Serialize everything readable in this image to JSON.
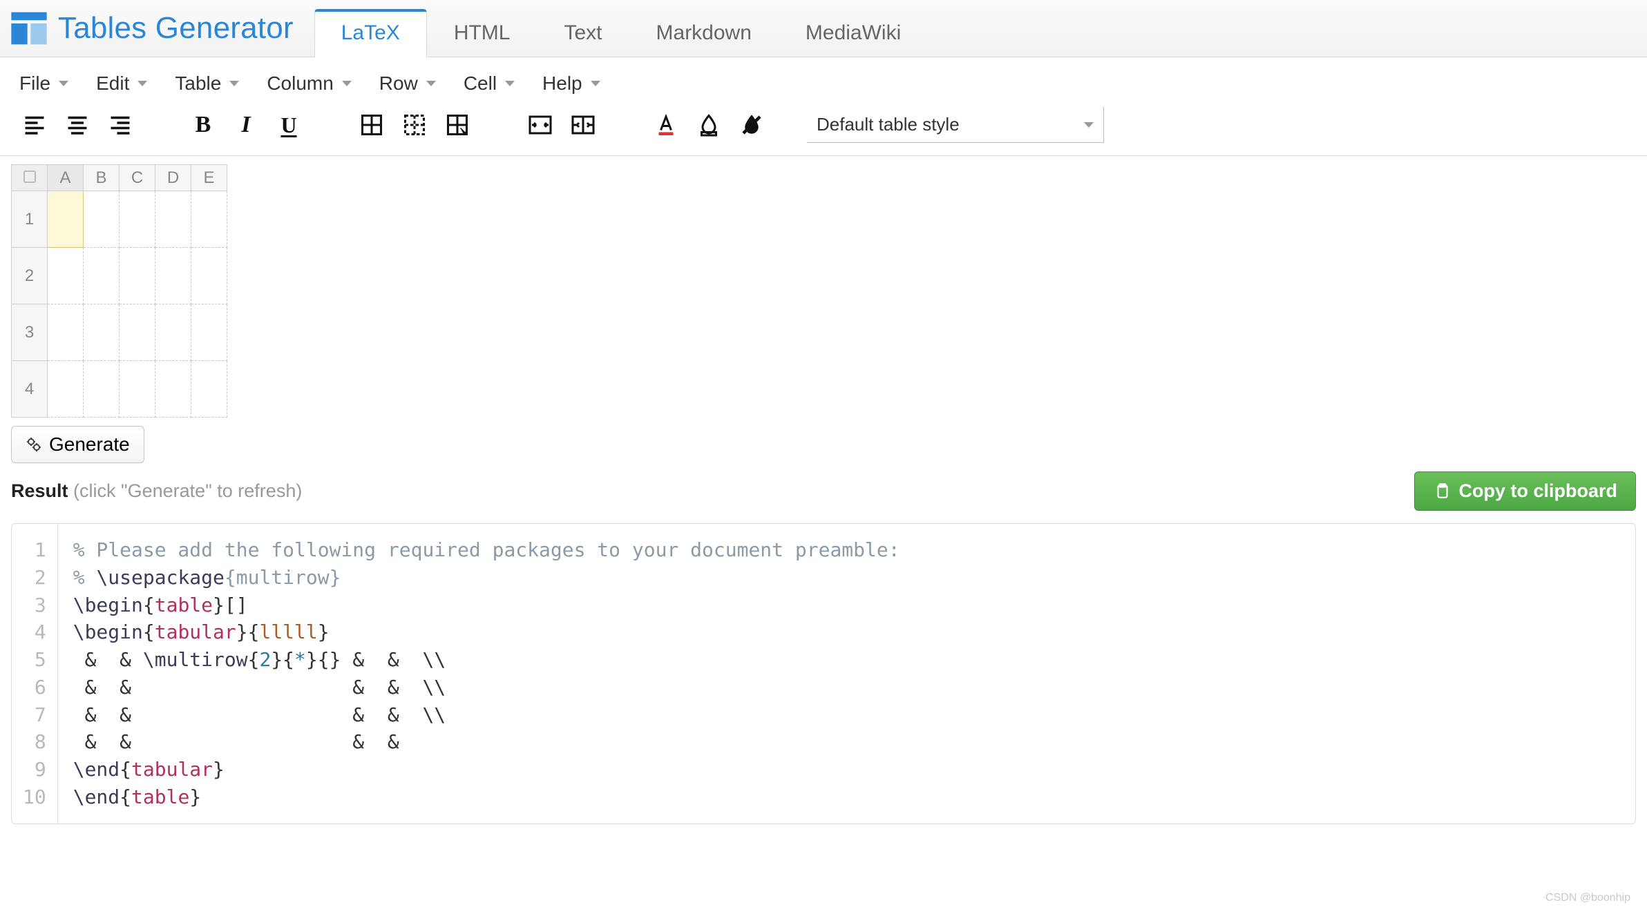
{
  "brand": "Tables Generator",
  "tabs": [
    "LaTeX",
    "HTML",
    "Text",
    "Markdown",
    "MediaWiki"
  ],
  "active_tab": 0,
  "menus": [
    "File",
    "Edit",
    "Table",
    "Column",
    "Row",
    "Cell",
    "Help"
  ],
  "style_dropdown": {
    "selected": "Default table style"
  },
  "grid": {
    "columns": [
      "A",
      "B",
      "C",
      "D",
      "E"
    ],
    "rows": [
      "1",
      "2",
      "3",
      "4"
    ],
    "selected_col": "A",
    "selected_row": "1"
  },
  "generate_label": "Generate",
  "result": {
    "title": "Result",
    "hint": "(click \"Generate\" to refresh)",
    "copy_label": "Copy to clipboard"
  },
  "code_raw": "% Please add the following required packages to your document preamble:\n% \\usepackage{multirow}\n\\begin{table}[]\n\\begin{tabular}{lllll}\n &  & \\multirow{2}{*}{} &  &  \\\\\n &  &                   &  &  \\\\\n &  &                   &  &  \\\\\n &  &                   &  & \n\\end{tabular}\n\\end{table}",
  "code_lines_count": 10,
  "watermark": "CSDN @boonhip"
}
